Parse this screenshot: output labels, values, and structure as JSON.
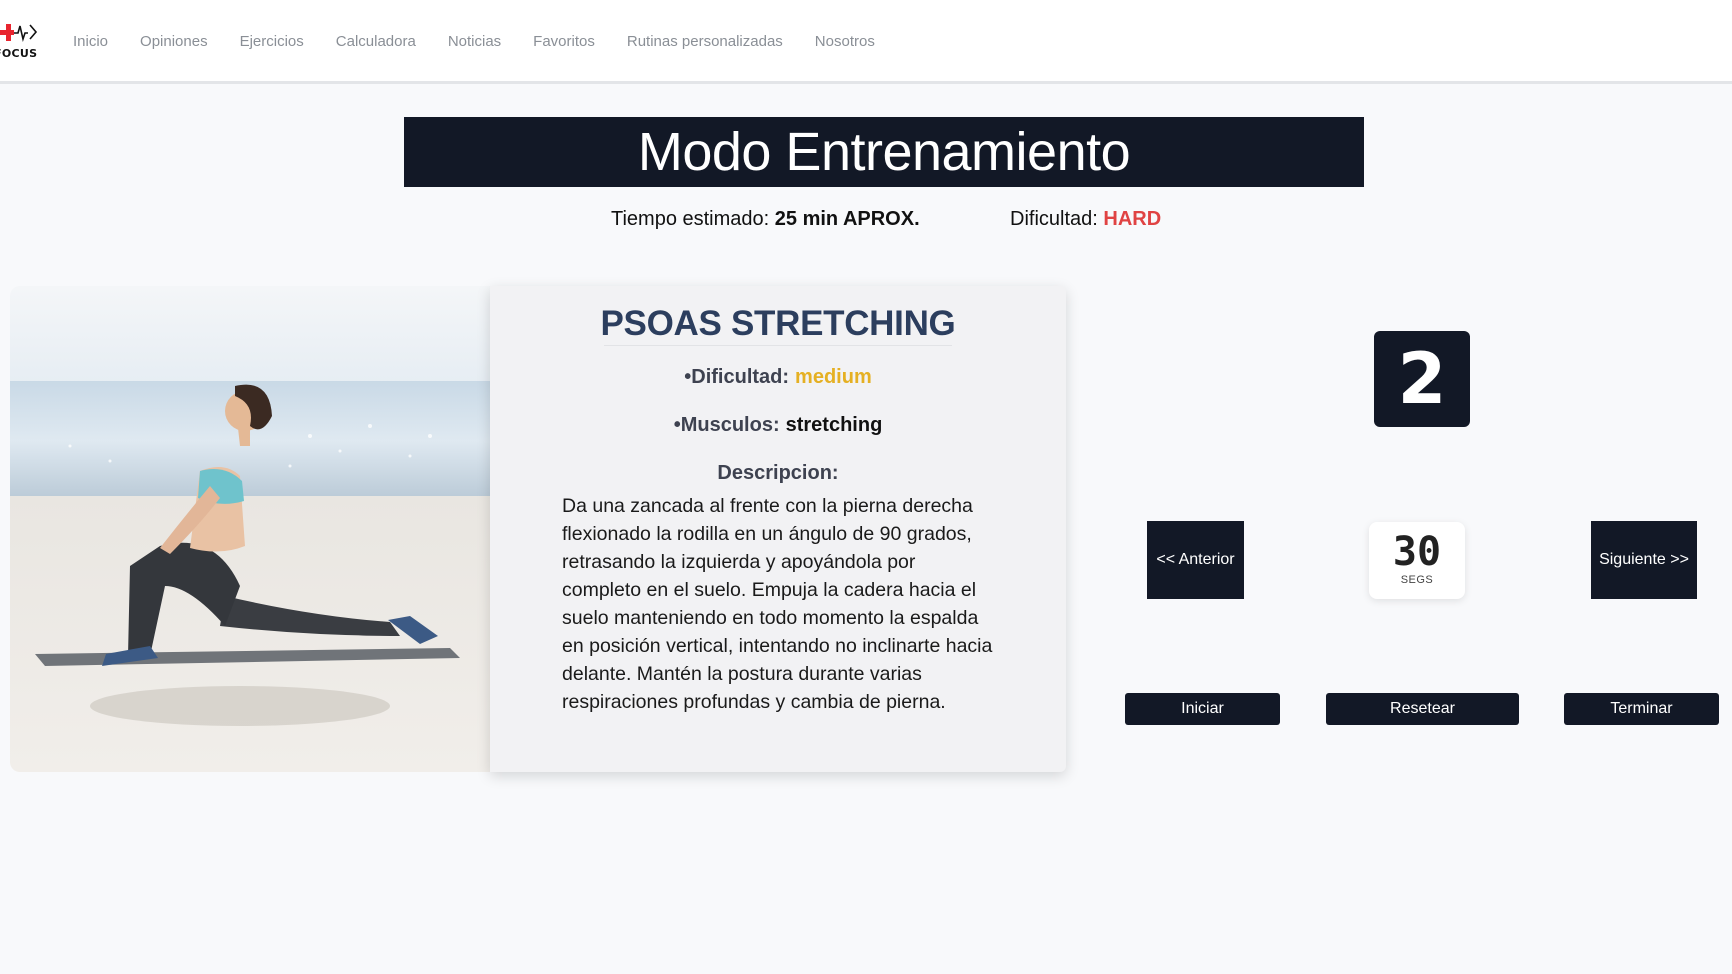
{
  "brand": {
    "logo_text": "FOCUS"
  },
  "nav": {
    "items": [
      {
        "label": "Inicio"
      },
      {
        "label": "Opiniones"
      },
      {
        "label": "Ejercicios"
      },
      {
        "label": "Calculadora"
      },
      {
        "label": "Noticias"
      },
      {
        "label": "Favoritos"
      },
      {
        "label": "Rutinas personalizadas"
      },
      {
        "label": "Nosotros"
      }
    ]
  },
  "page": {
    "title": "Modo Entrenamiento",
    "time_label": "Tiempo estimado:",
    "time_value": "25 min APROX.",
    "difficulty_label": "Dificultad:",
    "difficulty_value": "HARD"
  },
  "exercise": {
    "name": "PSOAS STRETCHING",
    "difficulty_label": "•Dificultad:",
    "difficulty_value": "medium",
    "muscles_label": "•Musculos:",
    "muscles_value": "stretching",
    "description_label": "Descripcion:",
    "description": "Da una zancada al frente con la pierna derecha flexionado la rodilla en un ángulo de 90 grados, retrasando la izquierda y apoyándola por completo en el suelo. Empuja la cadera hacia el suelo manteniendo en todo momento la espalda en posición vertical, intentando no inclinarte hacia delante. Mantén la postura durante varias respiraciones profundas y cambia de pierna.",
    "image_icon": "woman-stretching-on-beach-photo"
  },
  "controls": {
    "exercise_number": "2",
    "prev_label": "<< Anterior",
    "next_label": "Siguiente >>",
    "timer_value": "30",
    "timer_unit": "SEGS",
    "start_label": "Iniciar",
    "reset_label": "Resetear",
    "end_label": "Terminar"
  },
  "colors": {
    "dark": "#121826",
    "hard": "#e04343",
    "medium": "#e5b023",
    "heading": "#2c3e5e"
  }
}
